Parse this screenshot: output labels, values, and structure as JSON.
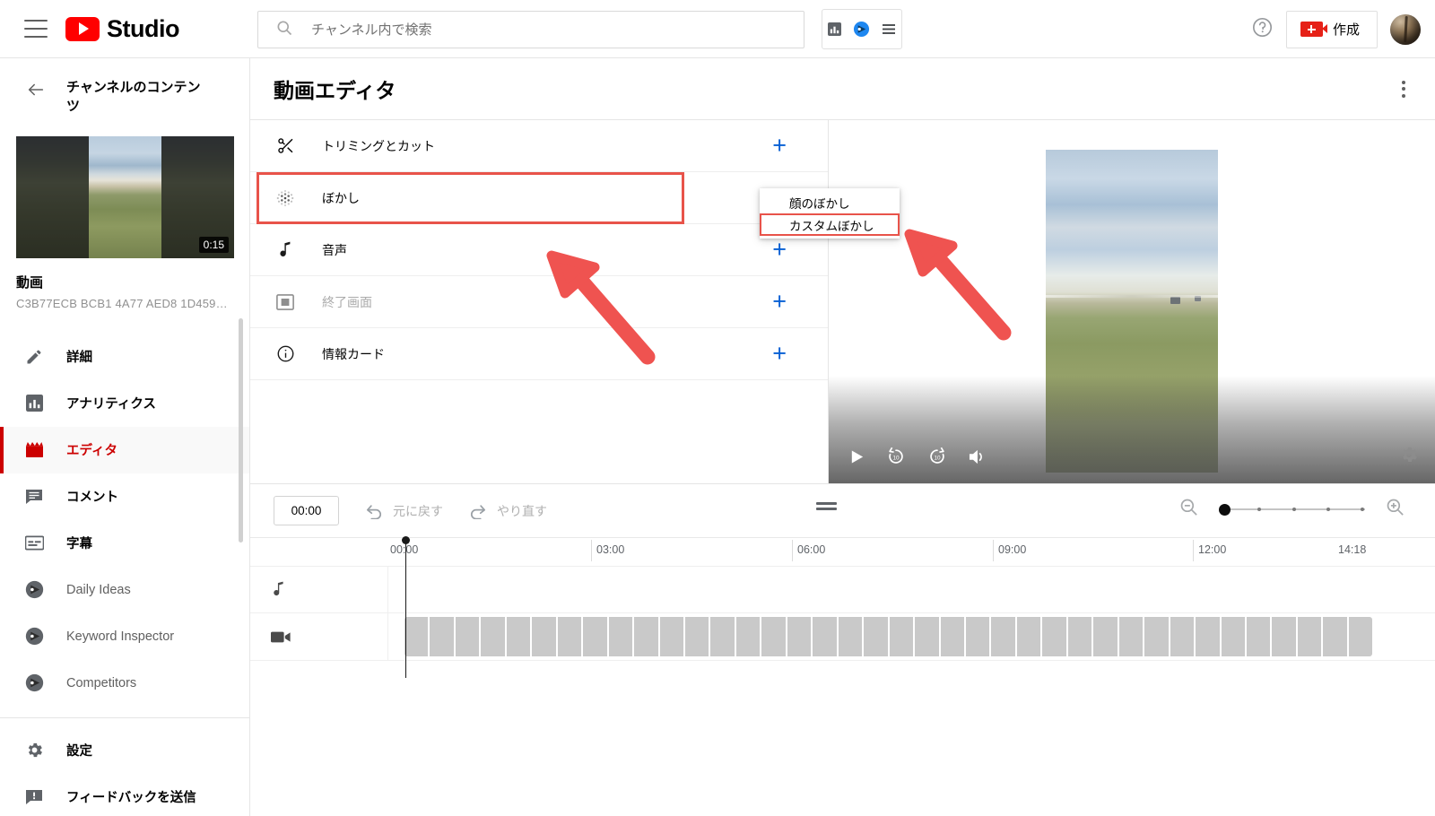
{
  "topbar": {
    "menu_icon": "hamburger-icon",
    "brand": "Studio",
    "search": {
      "placeholder": "チャンネル内で検索",
      "value": "",
      "icon": "search-icon"
    },
    "extension": {
      "analytics_icon": "bar-chart-icon",
      "vidiq_icon": "vidiq-logo-icon",
      "menu_icon": "list-icon"
    },
    "help_icon": "help-circle-icon",
    "create_label": "作成",
    "create_icon": "video-camera-plus-icon",
    "avatar": "user-avatar"
  },
  "sidebar": {
    "back_icon": "arrow-left-icon",
    "title": "チャンネルのコンテンツ",
    "thumbnail": {
      "duration": "0:15"
    },
    "video_label": "動画",
    "video_id": "C3B77ECB BCB1 4A77 AED8 1D459…",
    "items": [
      {
        "label": "詳細",
        "icon": "pencil-icon",
        "state": "normal"
      },
      {
        "label": "アナリティクス",
        "icon": "analytics-bar-icon",
        "state": "normal"
      },
      {
        "label": "エディタ",
        "icon": "clapperboard-icon",
        "state": "active"
      },
      {
        "label": "コメント",
        "icon": "comment-icon",
        "state": "normal"
      },
      {
        "label": "字幕",
        "icon": "subtitles-icon",
        "state": "normal"
      },
      {
        "label": "Daily Ideas",
        "icon": "vidiq-logo-icon",
        "state": "muted"
      },
      {
        "label": "Keyword Inspector",
        "icon": "vidiq-logo-icon",
        "state": "muted"
      },
      {
        "label": "Competitors",
        "icon": "vidiq-logo-icon",
        "state": "muted"
      }
    ],
    "footer_items": [
      {
        "label": "設定",
        "icon": "gear-icon"
      },
      {
        "label": "フィードバックを送信",
        "icon": "feedback-icon"
      }
    ]
  },
  "main": {
    "page_title": "動画エディタ",
    "kebab_icon": "more-vertical-icon",
    "tools": [
      {
        "label": "トリミングとカット",
        "icon": "scissors-icon",
        "add": "+",
        "disabled": false,
        "highlighted": false
      },
      {
        "label": "ぼかし",
        "icon": "blur-dots-icon",
        "add": "",
        "disabled": false,
        "highlighted": true
      },
      {
        "label": "音声",
        "icon": "music-note-icon",
        "add": "+",
        "disabled": false,
        "highlighted": false
      },
      {
        "label": "終了画面",
        "icon": "end-screen-icon",
        "add": "+",
        "disabled": true,
        "highlighted": false
      },
      {
        "label": "情報カード",
        "icon": "info-circle-icon",
        "add": "+",
        "disabled": false,
        "highlighted": false
      }
    ],
    "dropdown": {
      "items": [
        {
          "label": "顔のぼかし",
          "highlighted": false
        },
        {
          "label": "カスタムぼかし",
          "highlighted": true
        }
      ]
    }
  },
  "player": {
    "play_icon": "play-icon",
    "rewind_icon": "replay-10-icon",
    "forward_icon": "forward-10-icon",
    "volume_icon": "volume-icon",
    "settings_icon": "gear-icon"
  },
  "timeline": {
    "timecode": "00:00",
    "undo_label": "元に戻す",
    "undo_icon": "undo-arrow-icon",
    "redo_label": "やり直す",
    "redo_icon": "redo-arrow-icon",
    "drag_handle_icon": "drag-handle-icon",
    "zoom_out_icon": "zoom-out-icon",
    "zoom_in_icon": "zoom-in-icon",
    "zoom_value": 0,
    "ruler_marks": [
      "00:00",
      "03:00",
      "06:00",
      "09:00",
      "12:00",
      "14:18"
    ],
    "tracks": [
      {
        "icon": "music-note-icon",
        "name": "audio-track",
        "has_clip": false
      },
      {
        "icon": "video-camera-icon",
        "name": "video-track",
        "has_clip": true
      }
    ]
  },
  "annotations": {
    "arrow_color": "#ef5350",
    "arrows": [
      "arrow-pointing-to-blur-row",
      "arrow-pointing-to-custom-blur-menu-item"
    ],
    "highlight_color": "#e8534a"
  }
}
